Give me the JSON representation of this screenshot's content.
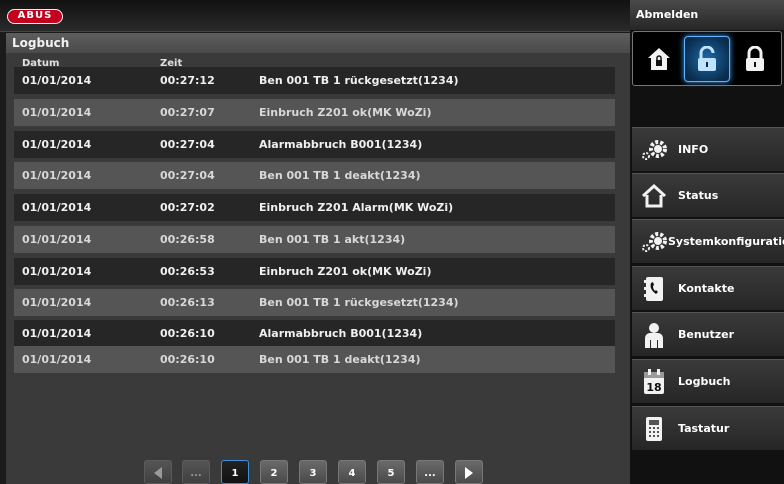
{
  "header": {
    "logo_text": "ABUS"
  },
  "logbook": {
    "title": "Logbuch",
    "columns": {
      "date": "Datum",
      "time": "Zeit"
    },
    "rows": [
      {
        "date": "01/01/2014",
        "time": "00:27:12",
        "event": "Ben 001 TB 1 rückgesetzt(1234)"
      },
      {
        "date": "01/01/2014",
        "time": "00:27:07",
        "event": "Einbruch Z201 ok(MK WoZi)"
      },
      {
        "date": "01/01/2014",
        "time": "00:27:04",
        "event": "Alarmabbruch B001(1234)"
      },
      {
        "date": "01/01/2014",
        "time": "00:27:04",
        "event": "Ben 001 TB 1 deakt(1234)"
      },
      {
        "date": "01/01/2014",
        "time": "00:27:02",
        "event": "Einbruch Z201 Alarm(MK WoZi)"
      },
      {
        "date": "01/01/2014",
        "time": "00:26:58",
        "event": "Ben 001 TB 1 akt(1234)"
      },
      {
        "date": "01/01/2014",
        "time": "00:26:53",
        "event": "Einbruch Z201 ok(MK WoZi)"
      },
      {
        "date": "01/01/2014",
        "time": "00:26:13",
        "event": "Ben 001 TB 1 rückgesetzt(1234)"
      },
      {
        "date": "01/01/2014",
        "time": "00:26:10",
        "event": "Alarmabbruch B001(1234)"
      },
      {
        "date": "01/01/2014",
        "time": "00:26:10",
        "event": "Ben 001 TB 1 deakt(1234)"
      }
    ]
  },
  "pagination": {
    "prev_icon": "triangle-left-icon",
    "ellipsis_left": "...",
    "pages": [
      "1",
      "2",
      "3",
      "4",
      "5"
    ],
    "current_page": "1",
    "ellipsis_right": "...",
    "next_icon": "triangle-right-icon"
  },
  "sidebar": {
    "logout_label": "Abmelden",
    "lock_modes": [
      {
        "icon": "house-lock-icon",
        "active": false
      },
      {
        "icon": "unlock-icon",
        "active": true
      },
      {
        "icon": "lock-icon",
        "active": false
      }
    ],
    "menu": [
      {
        "label": "INFO",
        "icon": "gears-icon"
      },
      {
        "label": "Status",
        "icon": "house-icon"
      },
      {
        "label": "Systemkonfiguratio",
        "icon": "gears-icon"
      },
      {
        "label": "Kontakte",
        "icon": "phonebook-icon"
      },
      {
        "label": "Benutzer",
        "icon": "user-icon"
      },
      {
        "label": "Logbuch",
        "icon": "calendar-icon"
      },
      {
        "label": "Tastatur",
        "icon": "keypad-icon"
      }
    ],
    "calendar_icon_number": "18"
  },
  "colors": {
    "accent_blue": "#3f8fd8",
    "brand_red": "#c3001d",
    "row_dark": "#262626",
    "row_light": "#555555"
  }
}
